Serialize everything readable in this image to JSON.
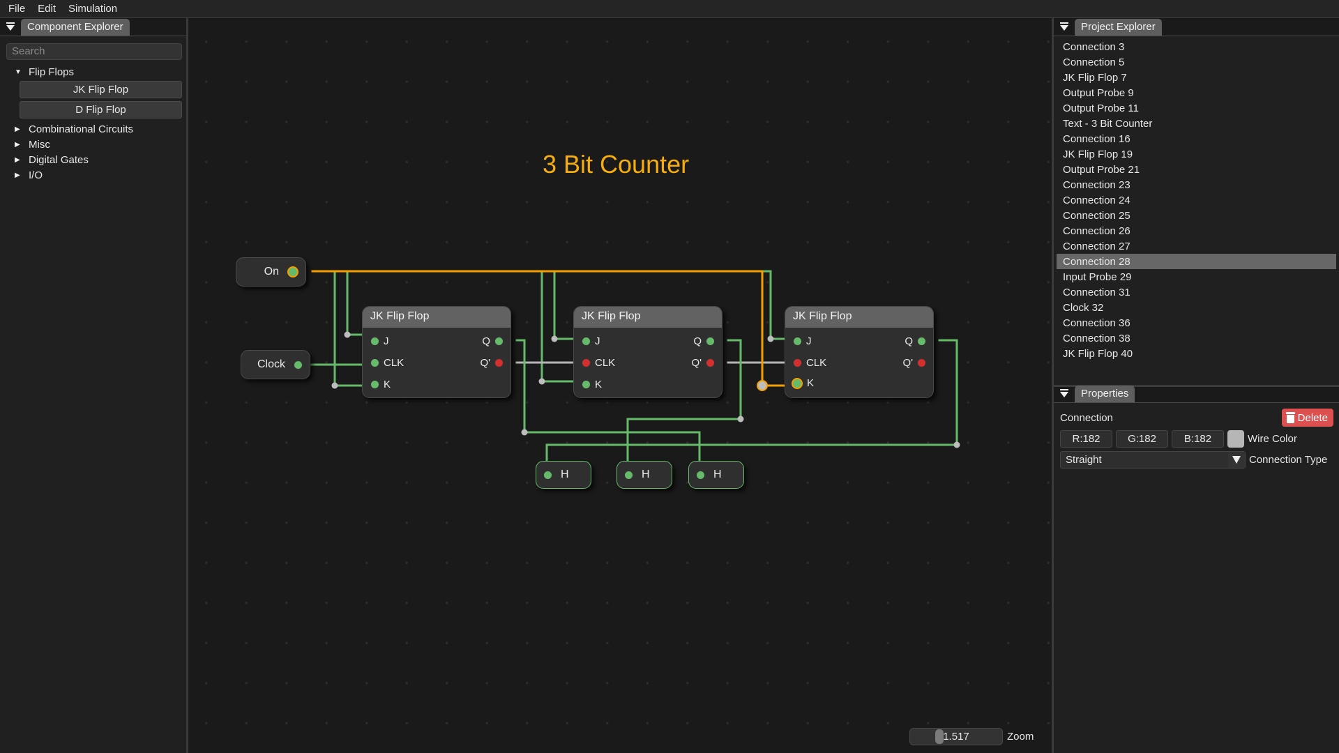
{
  "menu": [
    "File",
    "Edit",
    "Simulation"
  ],
  "component_explorer": {
    "title": "Component Explorer",
    "search_placeholder": "Search",
    "categories": [
      {
        "label": "Flip Flops",
        "expanded": true,
        "items": [
          "JK Flip Flop",
          "D Flip Flop"
        ]
      },
      {
        "label": "Combinational Circuits",
        "expanded": false
      },
      {
        "label": "Misc",
        "expanded": false
      },
      {
        "label": "Digital Gates",
        "expanded": false
      },
      {
        "label": "I/O",
        "expanded": false
      }
    ]
  },
  "project_explorer": {
    "title": "Project Explorer",
    "selected": "Connection 28",
    "items": [
      "Connection 3",
      "Connection 5",
      "JK Flip Flop 7",
      "Output Probe 9",
      "Output Probe 11",
      "Text - 3 Bit Counter",
      "Connection 16",
      "JK Flip Flop 19",
      "Output Probe 21",
      "Connection 23",
      "Connection 24",
      "Connection 25",
      "Connection 26",
      "Connection 27",
      "Connection 28",
      "Input Probe 29",
      "Connection 31",
      "Clock 32",
      "Connection 36",
      "Connection 38",
      "JK Flip Flop 40"
    ]
  },
  "properties": {
    "title": "Properties",
    "object_type": "Connection",
    "delete_label": "Delete",
    "r": "R:182",
    "g": "G:182",
    "b": "B:182",
    "wire_color_hex": "#b6b6b6",
    "wire_color_label": "Wire Color",
    "connection_type_value": "Straight",
    "connection_type_label": "Connection Type"
  },
  "canvas": {
    "title_text": "3 Bit Counter",
    "input_on_label": "On",
    "clock_label": "Clock",
    "flip_flops": [
      {
        "title": "JK Flip Flop",
        "pins": {
          "j": "J",
          "clk": "CLK",
          "k": "K",
          "q": "Q",
          "qn": "Q'"
        }
      },
      {
        "title": "JK Flip Flop",
        "pins": {
          "j": "J",
          "clk": "CLK",
          "k": "K",
          "q": "Q",
          "qn": "Q'"
        }
      },
      {
        "title": "JK Flip Flop",
        "pins": {
          "j": "J",
          "clk": "CLK",
          "k": "K",
          "q": "Q",
          "qn": "Q'"
        }
      }
    ],
    "probes": [
      "H",
      "H",
      "H"
    ],
    "zoom_value": "1.517",
    "zoom_label": "Zoom"
  },
  "colors": {
    "high": "#66bb6a",
    "low": "#d32f2f",
    "selected": "#f5a000",
    "accent_title": "#f5ad10",
    "delete": "#dc5050"
  }
}
